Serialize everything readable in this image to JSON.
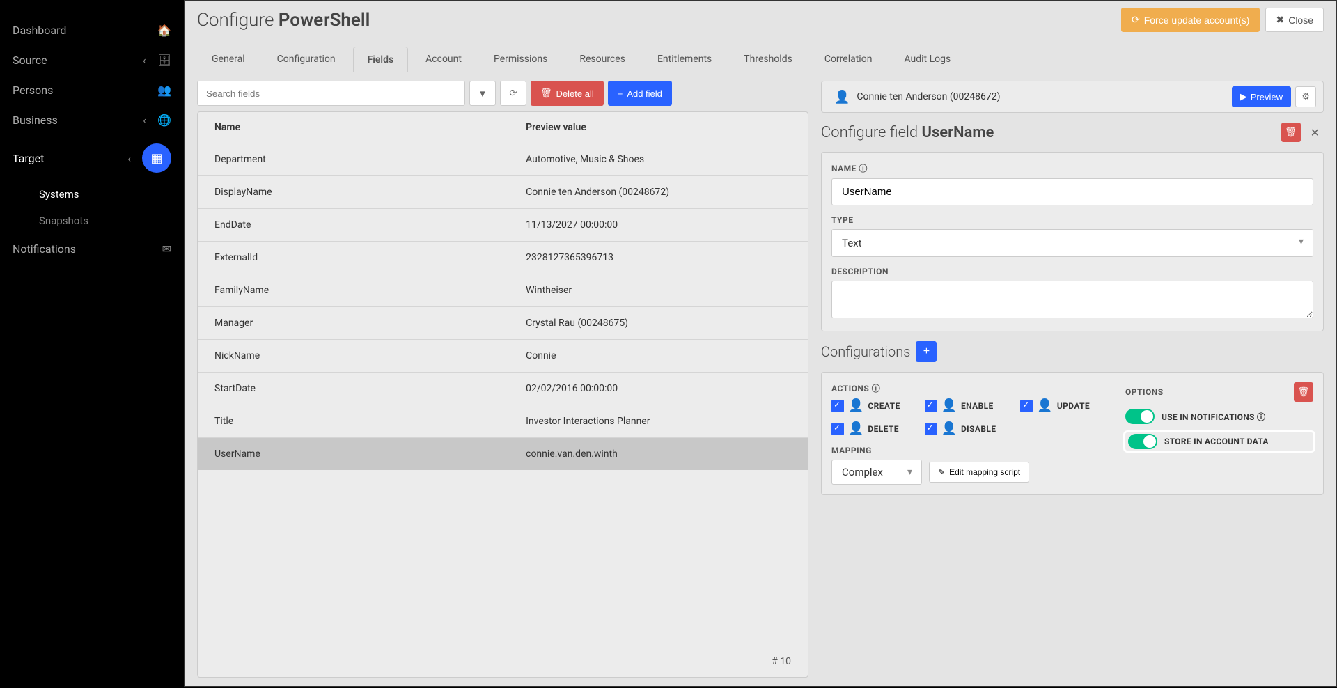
{
  "sidebar": {
    "items": [
      {
        "label": "Dashboard",
        "icon": "home"
      },
      {
        "label": "Source",
        "icon": "db",
        "chevron": true
      },
      {
        "label": "Persons",
        "icon": "users"
      },
      {
        "label": "Business",
        "icon": "globe",
        "chevron": true
      },
      {
        "label": "Target",
        "icon": "grid",
        "chevron": true,
        "expanded": true,
        "badge": true
      },
      {
        "label": "Notifications",
        "icon": "mail"
      }
    ],
    "subs": [
      {
        "label": "Systems",
        "active": true
      },
      {
        "label": "Snapshots",
        "active": false
      }
    ]
  },
  "page": {
    "title_pre": "Configure ",
    "title_main": "PowerShell",
    "force_update_label": "Force update account(s)",
    "close_label": "Close"
  },
  "tabs": [
    "General",
    "Configuration",
    "Fields",
    "Account",
    "Permissions",
    "Resources",
    "Entitlements",
    "Thresholds",
    "Correlation",
    "Audit Logs"
  ],
  "active_tab": 2,
  "toolbar": {
    "search_ph": "Search fields",
    "delete_all": "Delete all",
    "add_field": "Add field"
  },
  "table": {
    "head_name": "Name",
    "head_value": "Preview value",
    "rows": [
      {
        "name": "Department",
        "value": "Automotive, Music & Shoes"
      },
      {
        "name": "DisplayName",
        "value": "Connie ten Anderson (00248672)"
      },
      {
        "name": "EndDate",
        "value": "11/13/2027 00:00:00"
      },
      {
        "name": "ExternalId",
        "value": "2328127365396713"
      },
      {
        "name": "FamilyName",
        "value": "Wintheiser"
      },
      {
        "name": "Manager",
        "value": "Crystal Rau (00248675)"
      },
      {
        "name": "NickName",
        "value": "Connie"
      },
      {
        "name": "StartDate",
        "value": "02/02/2016 00:00:00"
      },
      {
        "name": "Title",
        "value": "Investor Interactions Planner"
      },
      {
        "name": "UserName",
        "value": "connie.van.den.winth"
      }
    ],
    "selected": 9,
    "count": "10"
  },
  "preview": {
    "person": "Connie ten Anderson (00248672)",
    "btn": "Preview"
  },
  "panel": {
    "title_pre": "Configure field ",
    "title_main": "UserName",
    "name_label": "NAME",
    "name_value": "UserName",
    "type_label": "TYPE",
    "type_value": "Text",
    "desc_label": "DESCRIPTION",
    "desc_value": ""
  },
  "config": {
    "title": "Configurations",
    "actions_label": "ACTIONS",
    "options_label": "OPTIONS",
    "actions": [
      "CREATE",
      "ENABLE",
      "UPDATE",
      "DELETE",
      "DISABLE"
    ],
    "options": [
      {
        "label": "USE IN NOTIFICATIONS",
        "info": true,
        "highlight": false
      },
      {
        "label": "STORE IN ACCOUNT DATA",
        "info": false,
        "highlight": true
      }
    ],
    "mapping_label": "MAPPING",
    "mapping_value": "Complex",
    "edit_script": "Edit mapping script"
  }
}
